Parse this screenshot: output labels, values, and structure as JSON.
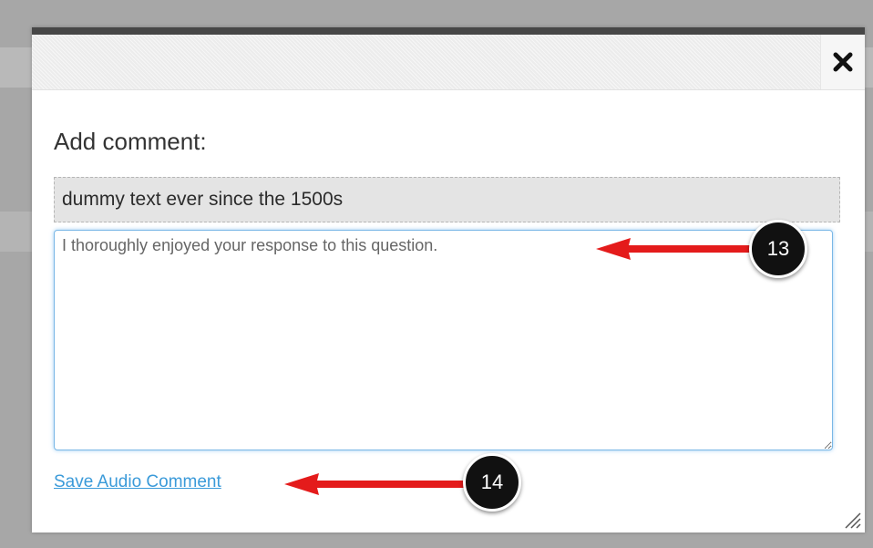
{
  "dialog": {
    "close_icon": "close-icon",
    "heading": "Add comment:",
    "quoted_text": "dummy text ever since the 1500s",
    "comment_value": "I thoroughly enjoyed your response to this question.",
    "audio_link": "Save Audio Comment",
    "resize_icon": "resize-grip-icon"
  },
  "callouts": [
    {
      "number": "13",
      "color": "#e41b1b"
    },
    {
      "number": "14",
      "color": "#e41b1b"
    }
  ],
  "colors": {
    "accent_link": "#3a9ad9",
    "focus_border": "#79b7e6",
    "callout_arrow": "#e41b1b",
    "callout_badge": "#111111"
  }
}
